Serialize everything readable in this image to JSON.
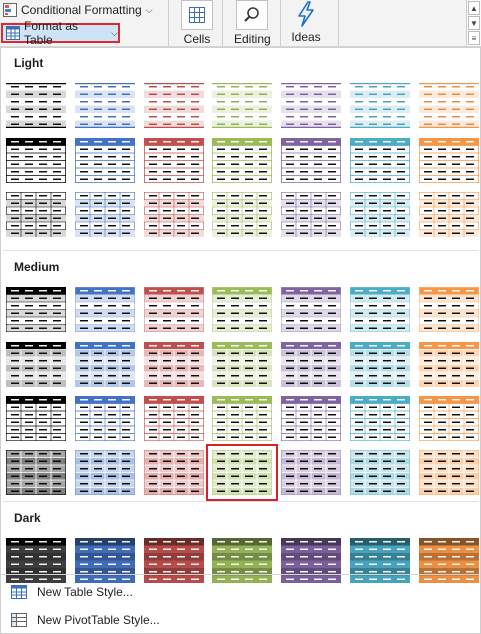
{
  "ribbon": {
    "conditional_formatting_label": "Conditional Formatting",
    "format_as_table_label": "Format as Table",
    "cells_label": "Cells",
    "editing_label": "Editing",
    "ideas_label": "Ideas"
  },
  "gallery": {
    "sections": [
      {
        "title": "Light",
        "rows": [
          [
            "#000000",
            "#4472c4",
            "#c0504d",
            "#9bbb59",
            "#8064a2",
            "#4bacc6",
            "#f79646"
          ],
          [
            "#000000",
            "#4472c4",
            "#c0504d",
            "#9bbb59",
            "#8064a2",
            "#4bacc6",
            "#f79646"
          ],
          [
            "#000000",
            "#4472c4",
            "#c0504d",
            "#9bbb59",
            "#8064a2",
            "#4bacc6",
            "#f79646"
          ]
        ]
      },
      {
        "title": "Medium",
        "rows": [
          [
            "#000000",
            "#4472c4",
            "#c0504d",
            "#9bbb59",
            "#8064a2",
            "#4bacc6",
            "#f79646"
          ],
          [
            "#000000",
            "#4472c4",
            "#c0504d",
            "#9bbb59",
            "#8064a2",
            "#4bacc6",
            "#f79646"
          ],
          [
            "#000000",
            "#4472c4",
            "#c0504d",
            "#9bbb59",
            "#8064a2",
            "#4bacc6",
            "#f79646"
          ],
          [
            "#000000",
            "#4472c4",
            "#c0504d",
            "#9bbb59",
            "#8064a2",
            "#4bacc6",
            "#f79646"
          ]
        ]
      },
      {
        "title": "Dark",
        "rows": [
          [
            "#000000",
            "#4472c4",
            "#c0504d",
            "#9bbb59",
            "#8064a2",
            "#4bacc6",
            "#f79646"
          ]
        ]
      }
    ],
    "selected": {
      "section": 1,
      "row": 3,
      "col": 3
    }
  },
  "menu": {
    "new_table_style": "New Table Style...",
    "new_pivottable_style": "New PivotTable Style..."
  },
  "colors": {
    "highlight_border": "#e0262f",
    "selected_fill": "#cfe3f6",
    "ideas_icon": "#1a73c8"
  }
}
